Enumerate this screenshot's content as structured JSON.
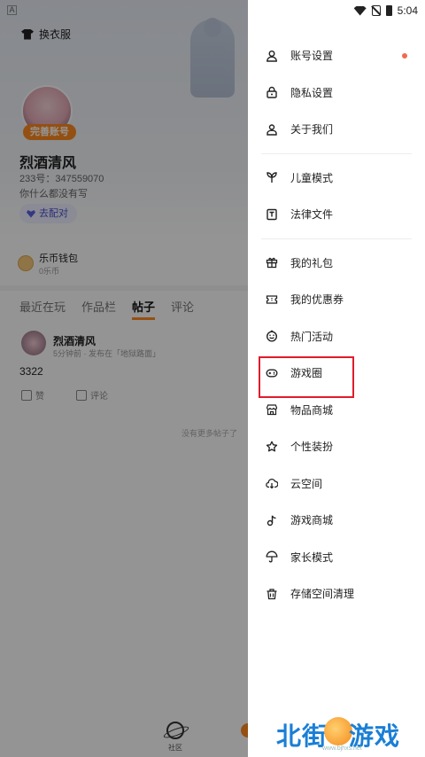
{
  "status_bar": {
    "time": "5:04",
    "left_badge": "A"
  },
  "profile": {
    "outfit_label": "换衣服",
    "complete_badge": "完善账号",
    "nickname": "烈酒清风",
    "uid": "233号：347559070",
    "bio": "你什么都没有写",
    "match_button": "去配对",
    "wallet_title": "乐币钱包",
    "wallet_sub": "0乐币",
    "tabs": [
      "最近在玩",
      "作品栏",
      "帖子",
      "评论"
    ],
    "active_tab": "帖子",
    "post": {
      "author": "烈酒清风",
      "meta": "5分钟前 · 发布在「地狱路面」",
      "text": "3322",
      "like": "赞",
      "comment": "评论"
    },
    "no_more": "没有更多帖子了",
    "bottom_nav": {
      "community": "社区"
    }
  },
  "drawer": {
    "items": [
      {
        "label": "账号设置",
        "icon": "user-icon",
        "has_dot": true
      },
      {
        "label": "隐私设置",
        "icon": "lock-icon"
      },
      {
        "label": "关于我们",
        "icon": "person-icon"
      },
      {
        "label": "儿童模式",
        "icon": "sprout-icon"
      },
      {
        "label": "法律文件",
        "icon": "document-icon"
      },
      {
        "label": "我的礼包",
        "icon": "gift-icon"
      },
      {
        "label": "我的优惠券",
        "icon": "coupon-icon"
      },
      {
        "label": "热门活动",
        "icon": "smile-icon"
      },
      {
        "label": "游戏圈",
        "icon": "gamepad-icon",
        "highlighted": true
      },
      {
        "label": "物品商城",
        "icon": "store-icon"
      },
      {
        "label": "个性装扮",
        "icon": "star-icon"
      },
      {
        "label": "云空间",
        "icon": "cloud-icon"
      },
      {
        "label": "游戏商城",
        "icon": "music-note-icon"
      },
      {
        "label": "家长模式",
        "icon": "umbrella-icon"
      },
      {
        "label": "存储空间清理",
        "icon": "trash-icon"
      }
    ],
    "highlight_color": "#e01c2c",
    "dot_color": "#f06a4f"
  },
  "watermark": {
    "left": "北街",
    "right": "游戏",
    "url": "www.bjhxs.net"
  }
}
